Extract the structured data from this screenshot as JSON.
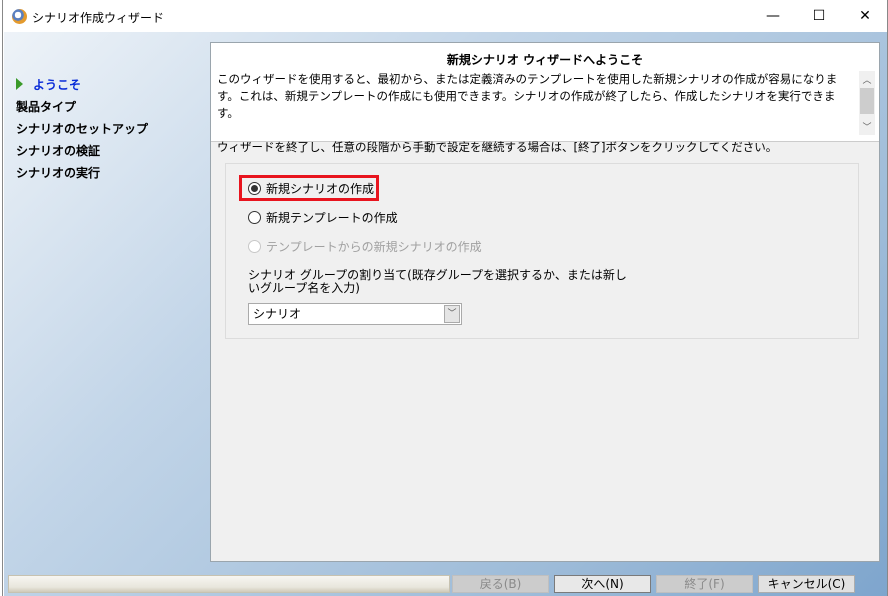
{
  "window": {
    "title": "シナリオ作成ウィザード",
    "minimize": "—",
    "maximize": "☐",
    "close": "✕"
  },
  "steps": [
    {
      "label": "ようこそ",
      "active": true
    },
    {
      "label": "製品タイプ"
    },
    {
      "label": "シナリオのセットアップ"
    },
    {
      "label": "シナリオの検証"
    },
    {
      "label": "シナリオの実行"
    }
  ],
  "header": {
    "title": "新規シナリオ ウィザードへようこそ",
    "line1": "このウィザードを使用すると、最初から、または定義済みのテンプレートを使用した新規シナリオの作成が容易になります。これは、新規テンプレートの作成にも使用できます。シナリオの作成が終了したら、作成したシナリオを実行できます。",
    "line2": "ウィザードを終了し、任意の段階から手動で設定を継続する場合は、[終了]ボタンをクリックしてください。"
  },
  "options": [
    {
      "label": "新規シナリオの作成",
      "selected": true
    },
    {
      "label": "新規テンプレートの作成"
    },
    {
      "label": "テンプレートからの新規シナリオの作成",
      "disabled": true
    }
  ],
  "group": {
    "label": "シナリオ グループの割り当て(既存グループを選択するか、または新しいグループ名を入力)",
    "value": "シナリオ"
  },
  "buttons": {
    "back": "戻る(B)",
    "next": "次へ(N)",
    "finish": "終了(F)",
    "cancel": "キャンセル(C)"
  },
  "colors": {
    "highlight": "#e8141e",
    "active_step": "#0a2cd8"
  }
}
